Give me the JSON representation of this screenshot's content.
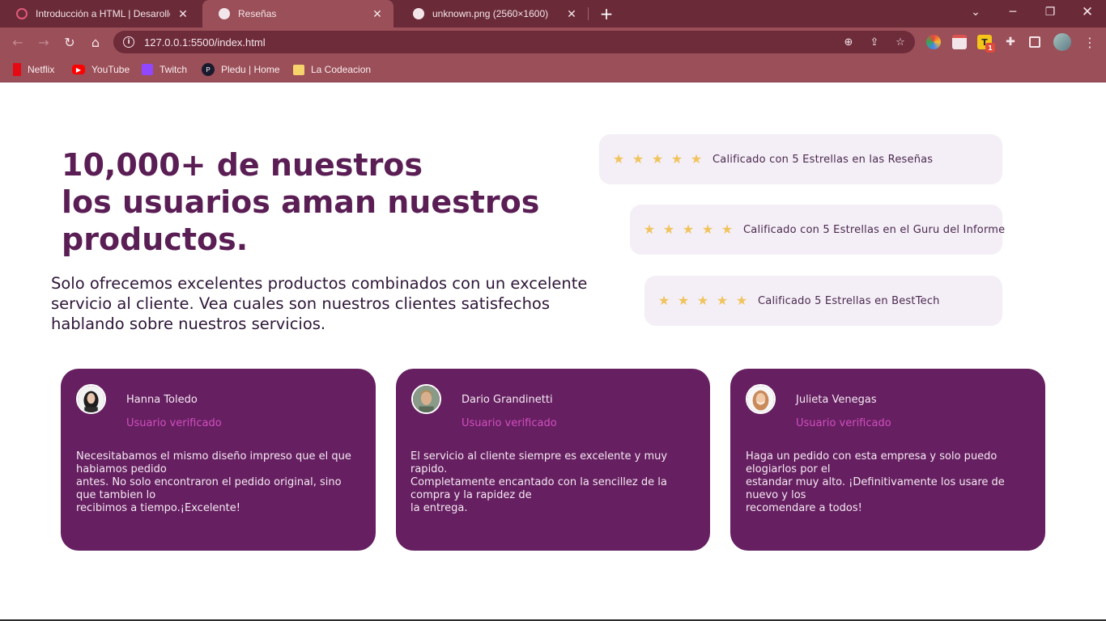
{
  "browser": {
    "tabs": [
      {
        "title": "Introducción a HTML | Desarollo W",
        "active": false
      },
      {
        "title": "Reseñas",
        "active": true
      },
      {
        "title": "unknown.png (2560×1600)",
        "active": false
      }
    ],
    "url": "127.0.0.1:5500/index.html",
    "bookmarks": [
      {
        "label": "Netflix",
        "icon": "netflix-icon"
      },
      {
        "label": "YouTube",
        "icon": "youtube-icon"
      },
      {
        "label": "Twitch",
        "icon": "twitch-icon"
      },
      {
        "label": "Pledu | Home",
        "icon": "pledu-icon"
      },
      {
        "label": "La Codeacion",
        "icon": "folder-icon"
      }
    ],
    "extension_badge": "1",
    "colors": {
      "tabbar": "#6b2a38",
      "toolbar": "#9b4f58",
      "omnibox": "#6e2b3a"
    }
  },
  "hero": {
    "headline": [
      "10,000+ de nuestros",
      "los usuarios aman nuestros",
      "productos."
    ],
    "subtext": [
      "Solo ofrecemos excelentes productos combinados con un excelente",
      "servicio al cliente. Vea cuales son nuestros clientes satisfechos",
      "hablando sobre nuestros servicios."
    ]
  },
  "ratings": [
    {
      "stars": 5,
      "text": "Calificado con 5 Estrellas en las Reseñas"
    },
    {
      "stars": 5,
      "text": "Calificado con 5 Estrellas en el Guru del Informe"
    },
    {
      "stars": 5,
      "text": "Calificado 5 Estrellas en BestTech"
    }
  ],
  "testimonials": [
    {
      "name": "Hanna Toledo",
      "status": "Usuario verificado",
      "text": [
        "Necesitabamos el mismo diseño impreso que el que",
        "habiamos pedido",
        "antes. No solo encontraron el pedido original, sino",
        "que tambien lo",
        "recibimos a tiempo.¡Excelente!"
      ]
    },
    {
      "name": "Dario Grandinetti",
      "status": "Usuario verificado",
      "text": [
        "El servicio al cliente siempre es excelente y muy",
        "rapido.",
        "Completamente encantado con la sencillez de la",
        "compra y la rapidez de",
        "la entrega."
      ]
    },
    {
      "name": "Julieta Venegas",
      "status": "Usuario verificado",
      "text": [
        "Haga un pedido con esta empresa y solo puedo",
        "elogiarlos por el",
        "estandar muy alto. ¡Definitivamente los usare de",
        "nuevo y los",
        "recomendare a todos!"
      ]
    }
  ],
  "colors": {
    "headline": "#5a1e55",
    "card_bg": "#661f60",
    "rating_bg": "#f4eef6",
    "star": "#f0c45c",
    "verified": "#d04fbf"
  }
}
